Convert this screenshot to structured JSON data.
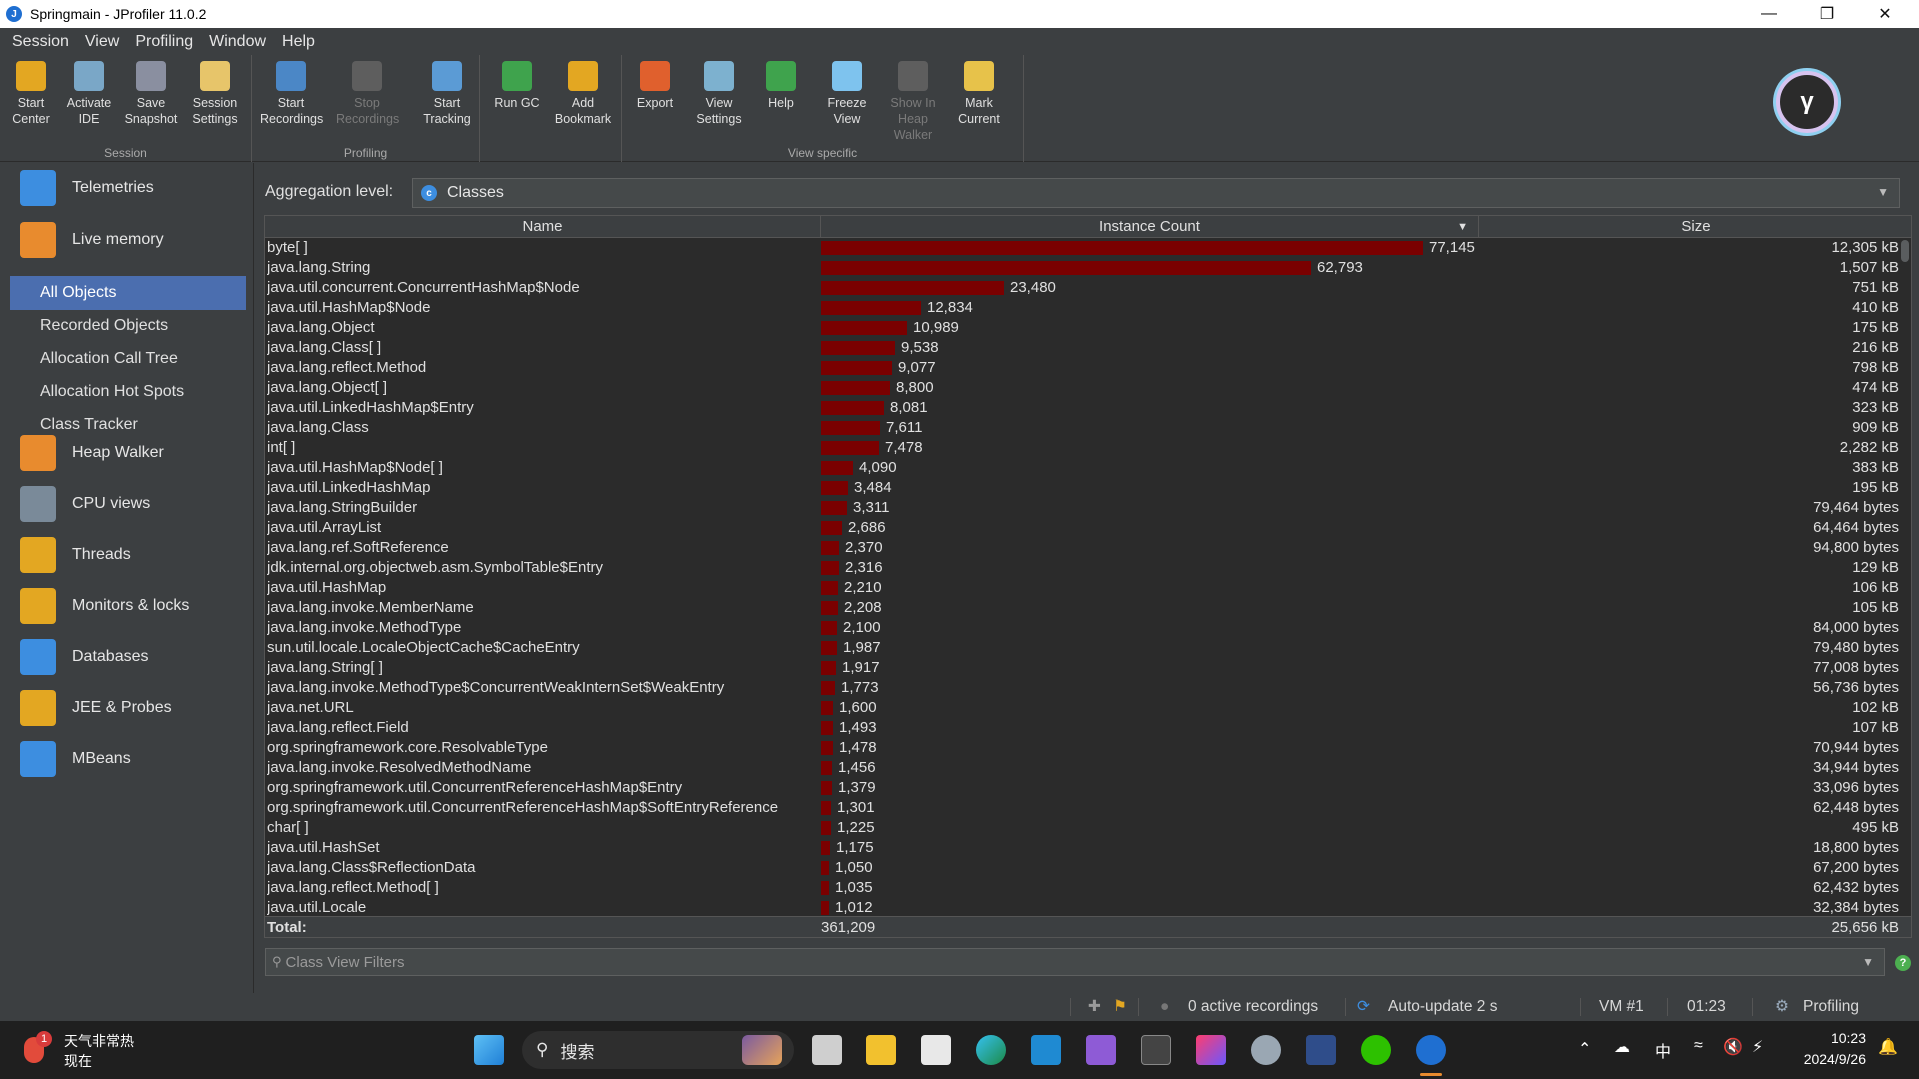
{
  "window": {
    "title": "Springmain - JProfiler 11.0.2"
  },
  "menu": [
    "Session",
    "View",
    "Profiling",
    "Window",
    "Help"
  ],
  "toolbar": {
    "groups": [
      {
        "label": "Session",
        "buttons": [
          {
            "label": "Start Center",
            "icon": "start-center-icon",
            "color": "#e3a722"
          },
          {
            "label": "Activate IDE",
            "icon": "activate-ide-icon",
            "color": "#7aa7c7"
          },
          {
            "label": "Save Snapshot",
            "icon": "save-snapshot-icon",
            "color": "#8a8fa0"
          },
          {
            "label": "Session Settings",
            "icon": "session-settings-icon",
            "color": "#e7c56a"
          }
        ]
      },
      {
        "label": "Profiling",
        "buttons": [
          {
            "label": "Start Recordings",
            "icon": "start-recordings-icon",
            "color": "#4b87c6"
          },
          {
            "label": "Stop Recordings",
            "icon": "stop-recordings-icon",
            "color": "#5e5e5e",
            "disabled": true
          },
          {
            "label": "Start Tracking",
            "icon": "start-tracking-icon",
            "color": "#5b9bd5"
          }
        ]
      },
      {
        "label": "",
        "buttons": [
          {
            "label": "Run GC",
            "icon": "run-gc-icon",
            "color": "#3fa34d"
          },
          {
            "label": "Add Bookmark",
            "icon": "add-bookmark-icon",
            "color": "#e3a722"
          }
        ]
      },
      {
        "label": "View specific",
        "buttons": [
          {
            "label": "Export",
            "icon": "export-icon",
            "color": "#e0602d"
          },
          {
            "label": "View Settings",
            "icon": "view-settings-icon",
            "color": "#7db1cf"
          },
          {
            "label": "Help",
            "icon": "help-icon",
            "color": "#3fa34d"
          },
          {
            "label": "Freeze View",
            "icon": "freeze-view-icon",
            "color": "#7ec3ee"
          },
          {
            "label": "Show In Heap Walker",
            "icon": "heap-walker-icon",
            "color": "#5e5e5e",
            "disabled": true
          },
          {
            "label": "Mark Current",
            "icon": "mark-current-icon",
            "color": "#e7c24a"
          }
        ]
      }
    ]
  },
  "sidebar": {
    "sections": [
      {
        "label": "Telemetries",
        "icon": "telemetries-icon",
        "color": "#3d8ee0"
      },
      {
        "label": "Live memory",
        "icon": "live-memory-icon",
        "color": "#e88b2e"
      },
      {
        "label": "Heap Walker",
        "icon": "heap-walker-section-icon",
        "color": "#e88b2e"
      },
      {
        "label": "CPU views",
        "icon": "cpu-views-icon",
        "color": "#7a8a99"
      },
      {
        "label": "Threads",
        "icon": "threads-icon",
        "color": "#e3a722"
      },
      {
        "label": "Monitors & locks",
        "icon": "lock-icon",
        "color": "#e3a722"
      },
      {
        "label": "Databases",
        "icon": "databases-icon",
        "color": "#3d8ee0"
      },
      {
        "label": "JEE & Probes",
        "icon": "probes-icon",
        "color": "#e3a722"
      },
      {
        "label": "MBeans",
        "icon": "mbeans-icon",
        "color": "#3d8ee0"
      }
    ],
    "live_memory_items": [
      "All Objects",
      "Recorded Objects",
      "Allocation Call Tree",
      "Allocation Hot Spots",
      "Class Tracker"
    ],
    "selected": "All Objects"
  },
  "aggregation": {
    "label": "Aggregation level:",
    "value": "Classes",
    "icon_letter": "c"
  },
  "table": {
    "columns": [
      "Name",
      "Instance Count",
      "Size"
    ],
    "sort_indicator": "▼",
    "max_count": 77145,
    "rows": [
      {
        "name": "byte[ ]",
        "count": 77145,
        "count_text": "77,145",
        "size": "12,305 kB"
      },
      {
        "name": "java.lang.String",
        "count": 62793,
        "count_text": "62,793",
        "size": "1,507 kB"
      },
      {
        "name": "java.util.concurrent.ConcurrentHashMap$Node",
        "count": 23480,
        "count_text": "23,480",
        "size": "751 kB"
      },
      {
        "name": "java.util.HashMap$Node",
        "count": 12834,
        "count_text": "12,834",
        "size": "410 kB"
      },
      {
        "name": "java.lang.Object",
        "count": 10989,
        "count_text": "10,989",
        "size": "175 kB"
      },
      {
        "name": "java.lang.Class[ ]",
        "count": 9538,
        "count_text": "9,538",
        "size": "216 kB"
      },
      {
        "name": "java.lang.reflect.Method",
        "count": 9077,
        "count_text": "9,077",
        "size": "798 kB"
      },
      {
        "name": "java.lang.Object[ ]",
        "count": 8800,
        "count_text": "8,800",
        "size": "474 kB"
      },
      {
        "name": "java.util.LinkedHashMap$Entry",
        "count": 8081,
        "count_text": "8,081",
        "size": "323 kB"
      },
      {
        "name": "java.lang.Class",
        "count": 7611,
        "count_text": "7,611",
        "size": "909 kB"
      },
      {
        "name": "int[ ]",
        "count": 7478,
        "count_text": "7,478",
        "size": "2,282 kB"
      },
      {
        "name": "java.util.HashMap$Node[ ]",
        "count": 4090,
        "count_text": "4,090",
        "size": "383 kB"
      },
      {
        "name": "java.util.LinkedHashMap",
        "count": 3484,
        "count_text": "3,484",
        "size": "195 kB"
      },
      {
        "name": "java.lang.StringBuilder",
        "count": 3311,
        "count_text": "3,311",
        "size": "79,464 bytes"
      },
      {
        "name": "java.util.ArrayList",
        "count": 2686,
        "count_text": "2,686",
        "size": "64,464 bytes"
      },
      {
        "name": "java.lang.ref.SoftReference",
        "count": 2370,
        "count_text": "2,370",
        "size": "94,800 bytes"
      },
      {
        "name": "jdk.internal.org.objectweb.asm.SymbolTable$Entry",
        "count": 2316,
        "count_text": "2,316",
        "size": "129 kB"
      },
      {
        "name": "java.util.HashMap",
        "count": 2210,
        "count_text": "2,210",
        "size": "106 kB"
      },
      {
        "name": "java.lang.invoke.MemberName",
        "count": 2208,
        "count_text": "2,208",
        "size": "105 kB"
      },
      {
        "name": "java.lang.invoke.MethodType",
        "count": 2100,
        "count_text": "2,100",
        "size": "84,000 bytes"
      },
      {
        "name": "sun.util.locale.LocaleObjectCache$CacheEntry",
        "count": 1987,
        "count_text": "1,987",
        "size": "79,480 bytes"
      },
      {
        "name": "java.lang.String[ ]",
        "count": 1917,
        "count_text": "1,917",
        "size": "77,008 bytes"
      },
      {
        "name": "java.lang.invoke.MethodType$ConcurrentWeakInternSet$WeakEntry",
        "count": 1773,
        "count_text": "1,773",
        "size": "56,736 bytes"
      },
      {
        "name": "java.net.URL",
        "count": 1600,
        "count_text": "1,600",
        "size": "102 kB"
      },
      {
        "name": "java.lang.reflect.Field",
        "count": 1493,
        "count_text": "1,493",
        "size": "107 kB"
      },
      {
        "name": "org.springframework.core.ResolvableType",
        "count": 1478,
        "count_text": "1,478",
        "size": "70,944 bytes"
      },
      {
        "name": "java.lang.invoke.ResolvedMethodName",
        "count": 1456,
        "count_text": "1,456",
        "size": "34,944 bytes"
      },
      {
        "name": "org.springframework.util.ConcurrentReferenceHashMap$Entry",
        "count": 1379,
        "count_text": "1,379",
        "size": "33,096 bytes"
      },
      {
        "name": "org.springframework.util.ConcurrentReferenceHashMap$SoftEntryReference",
        "count": 1301,
        "count_text": "1,301",
        "size": "62,448 bytes"
      },
      {
        "name": "char[ ]",
        "count": 1225,
        "count_text": "1,225",
        "size": "495 kB"
      },
      {
        "name": "java.util.HashSet",
        "count": 1175,
        "count_text": "1,175",
        "size": "18,800 bytes"
      },
      {
        "name": "java.lang.Class$ReflectionData",
        "count": 1050,
        "count_text": "1,050",
        "size": "67,200 bytes"
      },
      {
        "name": "java.lang.reflect.Method[ ]",
        "count": 1035,
        "count_text": "1,035",
        "size": "62,432 bytes"
      },
      {
        "name": "java.util.Locale",
        "count": 1012,
        "count_text": "1,012",
        "size": "32,384 bytes"
      }
    ],
    "total": {
      "label": "Total:",
      "count": "361,209",
      "size": "25,656 kB"
    }
  },
  "filter": {
    "placeholder": "Class View Filters"
  },
  "status": {
    "recordings": "0 active recordings",
    "auto_update": "Auto-update 2 s",
    "vm": "VM #1",
    "time": "01:23",
    "mode": "Profiling"
  },
  "taskbar": {
    "weather_line1": "天气非常热",
    "weather_line2": "现在",
    "weather_badge": "1",
    "search_label": "搜索",
    "ime": "中",
    "clock_time": "10:23",
    "clock_date": "2024/9/26"
  }
}
